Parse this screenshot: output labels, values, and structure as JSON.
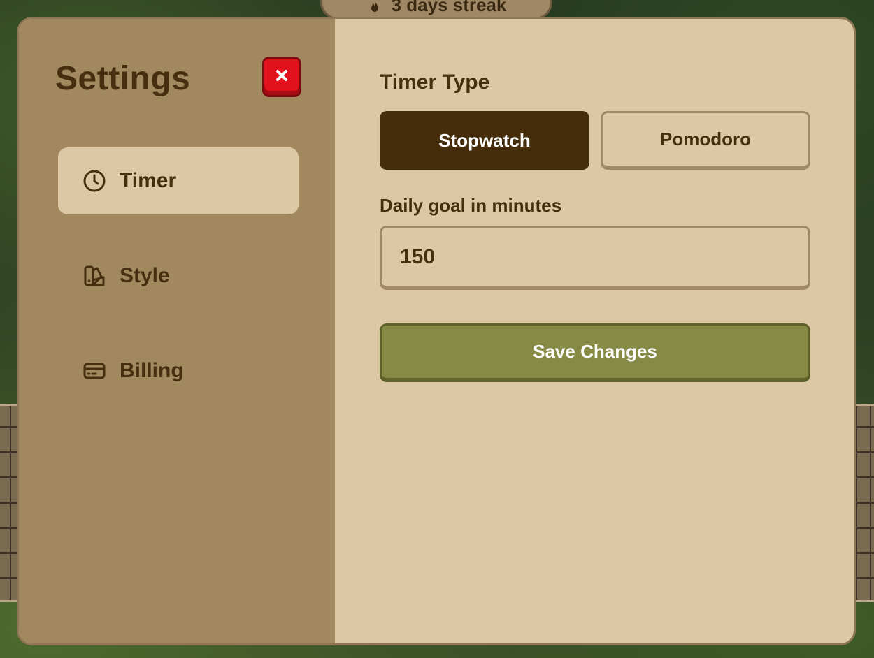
{
  "background": {
    "streak_text": "3 days streak",
    "streak_icon": "flame-icon"
  },
  "settings": {
    "title": "Settings",
    "close_icon": "close-icon",
    "colors": {
      "sidebar_bg": "#a2885f",
      "content_bg": "#dcc8a4",
      "text": "#452f10",
      "close_red": "#e3111b",
      "active_segment": "#452d0c",
      "save_green": "#868a44"
    }
  },
  "sidebar": {
    "items": [
      {
        "label": "Timer",
        "icon": "clock-icon",
        "active": true
      },
      {
        "label": "Style",
        "icon": "palette-icon",
        "active": false
      },
      {
        "label": "Billing",
        "icon": "credit-card-icon",
        "active": false
      }
    ]
  },
  "timer": {
    "type_label": "Timer Type",
    "options": [
      {
        "label": "Stopwatch",
        "selected": true
      },
      {
        "label": "Pomodoro",
        "selected": false
      }
    ],
    "goal_label": "Daily goal in minutes",
    "goal_value": "150",
    "save_label": "Save Changes"
  }
}
